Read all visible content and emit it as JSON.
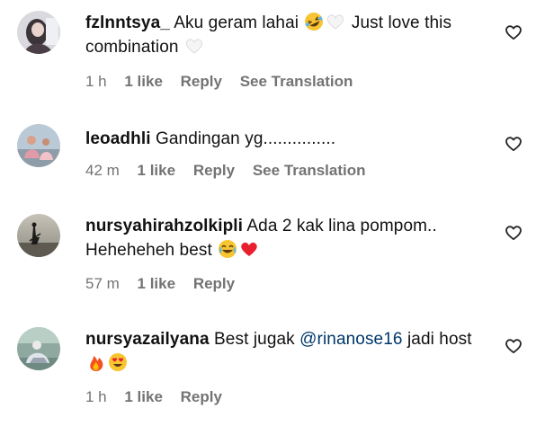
{
  "comments": [
    {
      "username": "fzlnntsya_",
      "text_1": "Aku geram lahai",
      "text_2": "Just love this combination",
      "time": "1 h",
      "likes": "1 like",
      "reply": "Reply",
      "translate": "See Translation",
      "avatar_icon": "avatar-profile-photo",
      "emojis": [
        "rolling-on-floor-laughing-emoji",
        "white-heart-emoji",
        "white-heart-emoji"
      ]
    },
    {
      "username": "leoadhli",
      "text_1": "Gandingan yg...............",
      "time": "42 m",
      "likes": "1 like",
      "reply": "Reply",
      "translate": "See Translation",
      "avatar_icon": "avatar-profile-photo"
    },
    {
      "username": "nursyahirahzolkipli",
      "text_1": "Ada 2 kak lina pompom.. Heheheheh best",
      "time": "57 m",
      "likes": "1 like",
      "reply": "Reply",
      "avatar_icon": "avatar-profile-photo",
      "emojis": [
        "face-with-tears-of-joy-emoji",
        "red-heart-emoji"
      ]
    },
    {
      "username": "nursyazailyana",
      "text_1": "Best jugak",
      "mention": "@rinanose16",
      "text_2": "jadi host",
      "time": "1 h",
      "likes": "1 like",
      "reply": "Reply",
      "avatar_icon": "avatar-profile-photo",
      "emojis": [
        "fire-emoji",
        "smiling-face-with-heart-eyes-emoji"
      ]
    }
  ],
  "colors": {
    "text": "#111111",
    "meta": "#737373",
    "mention": "#00376b",
    "background": "#ffffff"
  },
  "icons": {
    "like": "heart-outline-icon"
  }
}
